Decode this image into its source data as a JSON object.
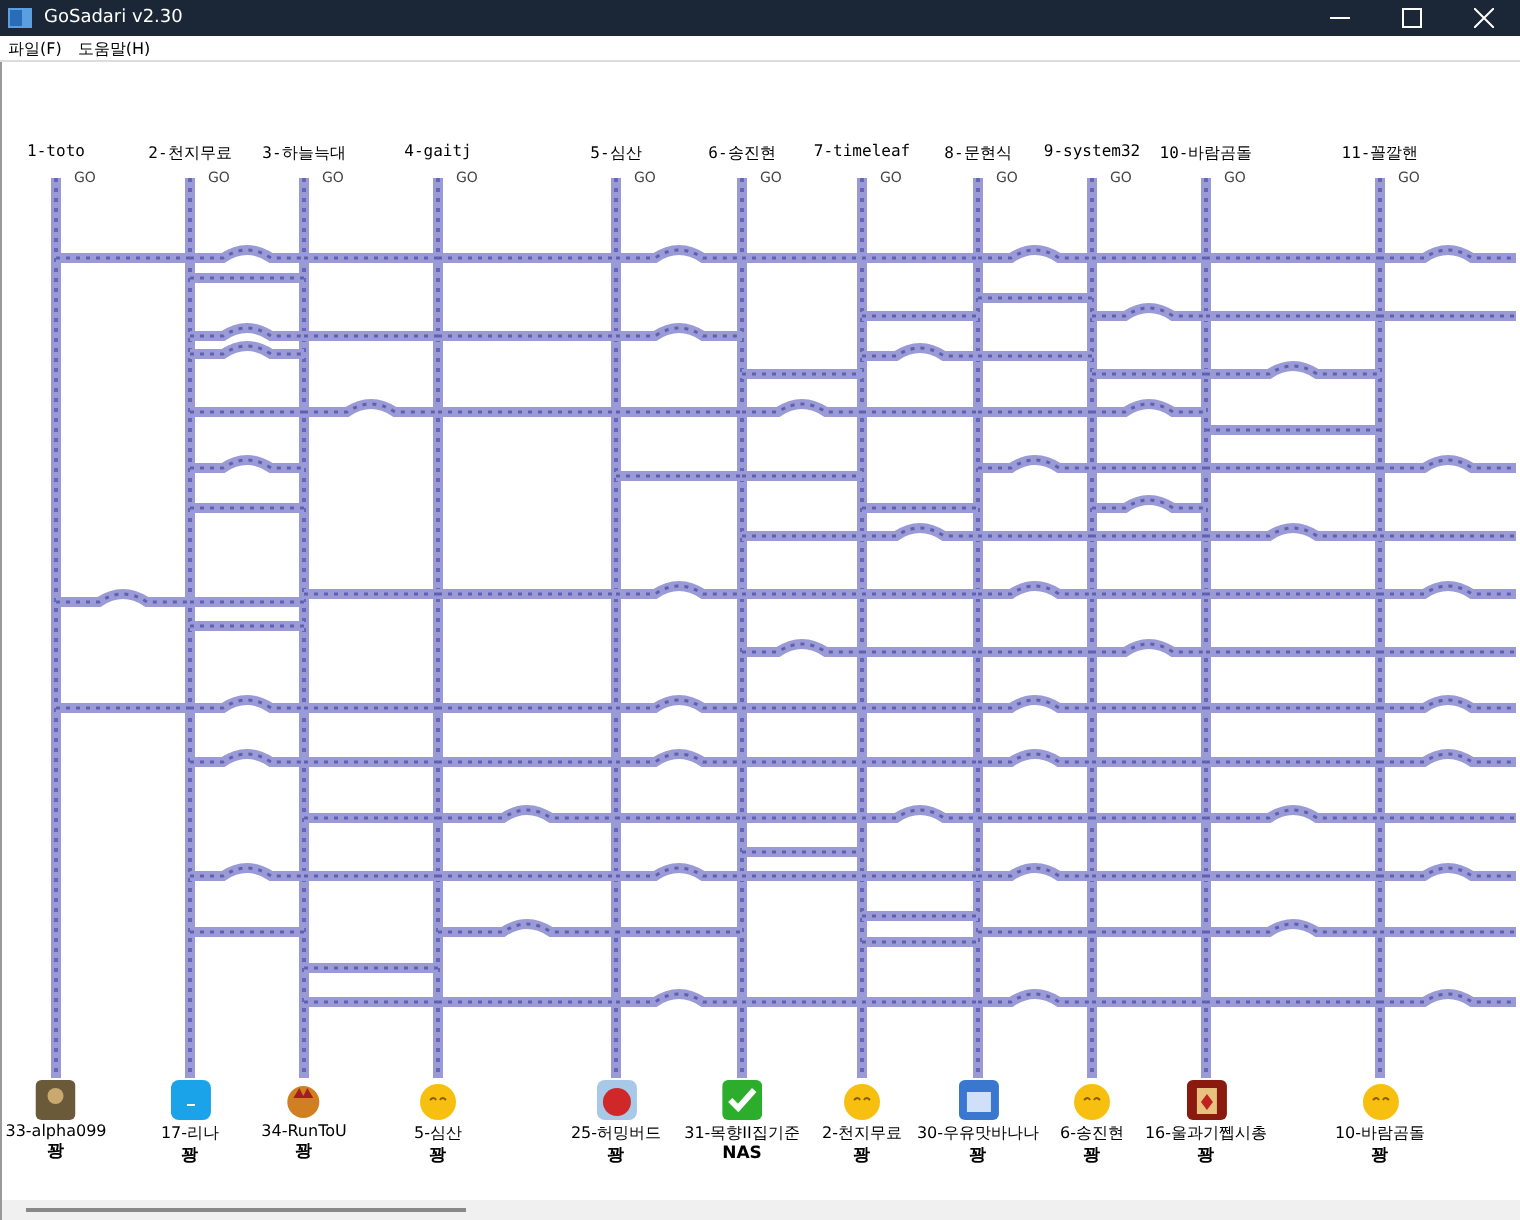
{
  "window": {
    "title": "GoSadari v2.30"
  },
  "menu": [
    "파일(F)",
    "도움말(H)"
  ],
  "players": [
    {
      "name": "1-toto",
      "go": "GO"
    },
    {
      "name": "2-천지무료",
      "go": "GO"
    },
    {
      "name": "3-하늘늑대",
      "go": "GO"
    },
    {
      "name": "4-gaitj",
      "go": "GO"
    },
    {
      "name": "5-심산",
      "go": "GO"
    },
    {
      "name": "6-송진현",
      "go": "GO"
    },
    {
      "name": "7-timeleaf",
      "go": "GO"
    },
    {
      "name": "8-문현식",
      "go": "GO"
    },
    {
      "name": "9-system32",
      "go": "GO"
    },
    {
      "name": "10-바람곰돌",
      "go": "GO"
    },
    {
      "name": "11-꼴깔핸",
      "go": "GO"
    }
  ],
  "results": [
    {
      "name": "33-alpha099",
      "result": "꽝"
    },
    {
      "name": "17-리나",
      "result": "꽝"
    },
    {
      "name": "34-RunToU",
      "result": "꽝"
    },
    {
      "name": "5-심산",
      "result": "꽝"
    },
    {
      "name": "25-허밍버드",
      "result": "꽝"
    },
    {
      "name": "31-목향II집기준",
      "result": "NAS"
    },
    {
      "name": "2-천지무료",
      "result": "꽝"
    },
    {
      "name": "30-우유맛바나나",
      "result": "꽝"
    },
    {
      "name": "6-송진현",
      "result": "꽝"
    },
    {
      "name": "16-울과기쩹시총",
      "result": "꽝"
    },
    {
      "name": "10-바람곰돌",
      "result": "꽝"
    }
  ]
}
